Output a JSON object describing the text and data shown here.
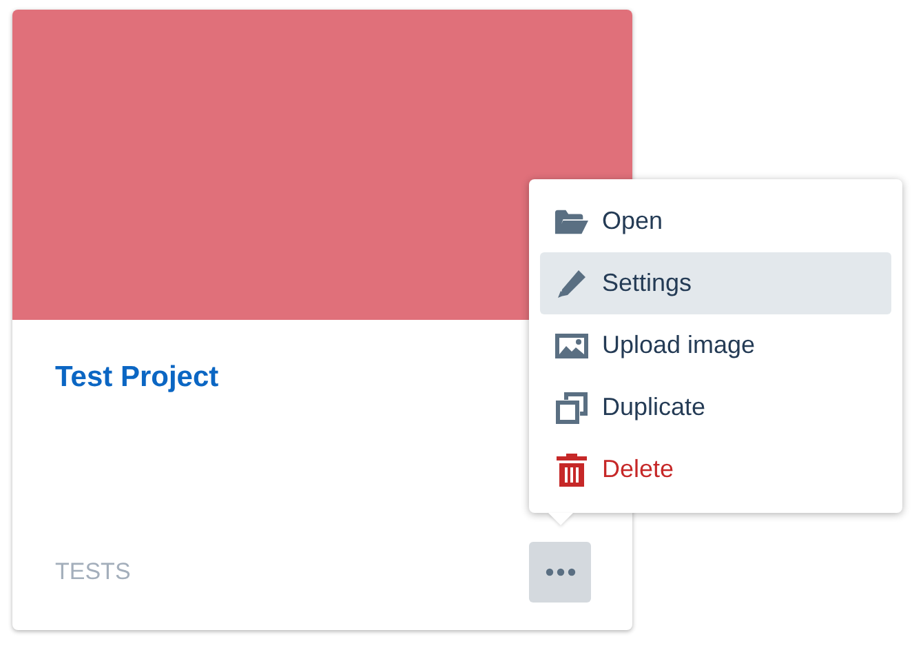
{
  "card": {
    "title": "Test Project",
    "category": "TESTS",
    "menu_open": true
  },
  "menu": {
    "items": [
      {
        "label": "Open",
        "kind": "default",
        "selected": false
      },
      {
        "label": "Settings",
        "kind": "default",
        "selected": true
      },
      {
        "label": "Upload image",
        "kind": "default",
        "selected": false
      },
      {
        "label": "Duplicate",
        "kind": "default",
        "selected": false
      },
      {
        "label": "Delete",
        "kind": "danger",
        "selected": false
      }
    ]
  }
}
